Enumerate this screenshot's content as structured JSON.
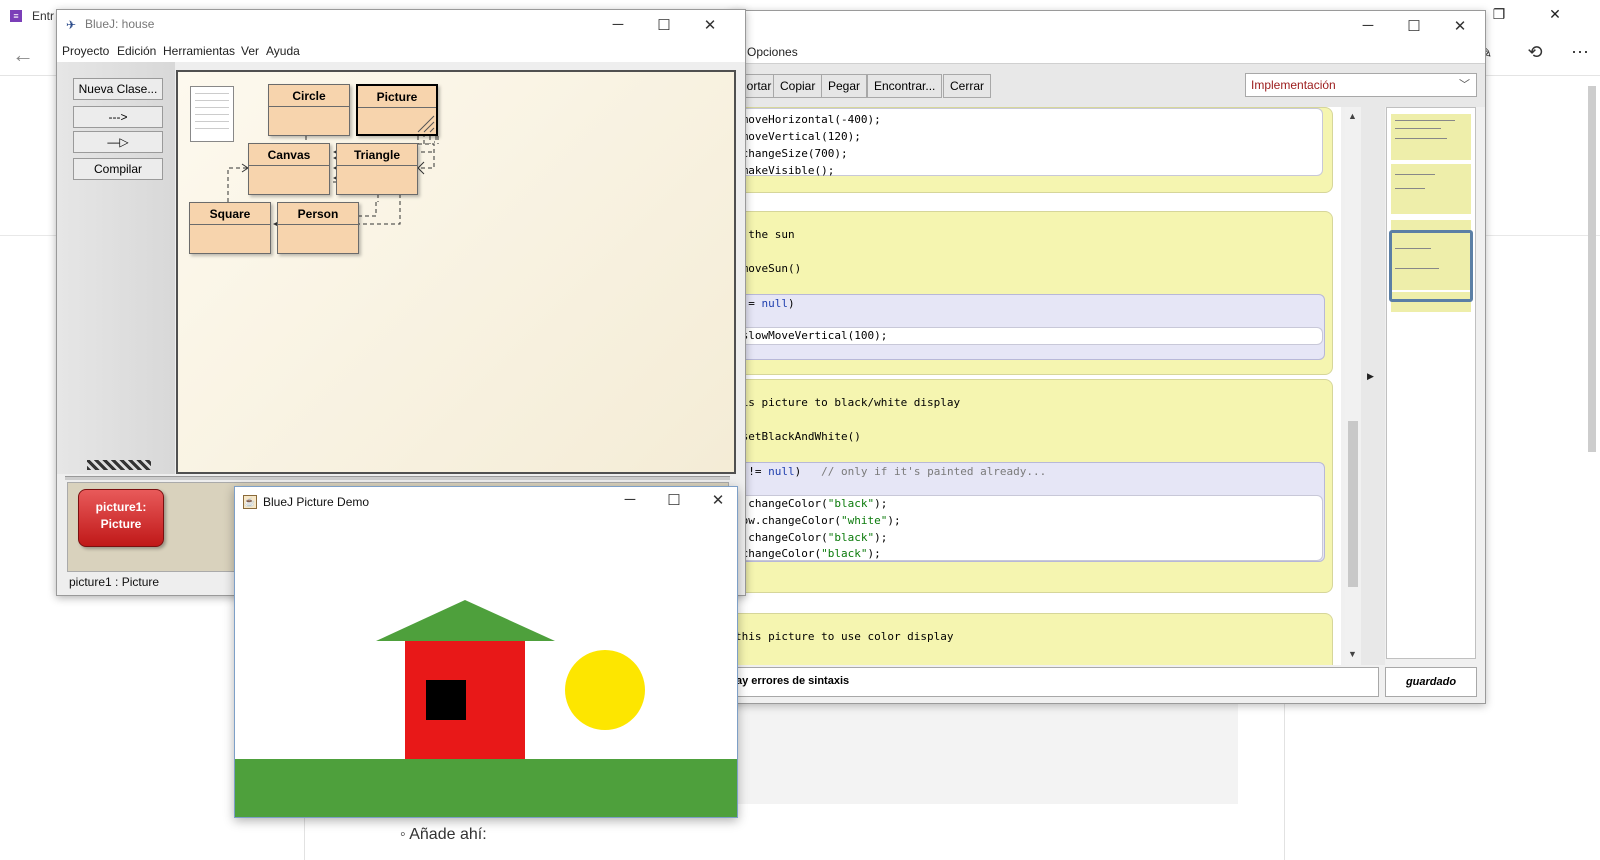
{
  "background": {
    "title": "Entr",
    "bullet_text": "Añade ahí:"
  },
  "editor": {
    "menu": [
      "s",
      "Opciones"
    ],
    "toolbar": [
      "Cortar",
      "Copiar",
      "Pegar",
      "Encontrar...",
      "Cerrar"
    ],
    "view_select": "Implementación",
    "status": "ay errores de sintaxis",
    "saved_label": "guardado",
    "code": {
      "l1": ".moveHorizontal(-400);",
      "l2": ".moveVertical(120);",
      "l3": ".changeSize(700);",
      "l4": ".makeVisible();",
      "l5": "n the sun",
      "l6": " moveSun()",
      "l7a": " != ",
      "l7b": "null",
      "l7c": ")",
      "l8": ".slowMoveVertical(100);",
      "l9": "his picture to black/white display",
      "l10": " setBlackAndWhite()",
      "l11a": "l != ",
      "l11b": "null",
      "l11c": ")   ",
      "l11d": "// only if it's painted already...",
      "l12a": "l.changeColor(",
      "l12b": "\"black\"",
      "l12c": ");",
      "l13a": "dow.changeColor(",
      "l13b": "\"white\"",
      "l13c": ");",
      "l14a": "f.changeColor(",
      "l14b": "\"black\"",
      "l14c": ");",
      "l15a": ".changeColor(",
      "l15b": "\"black\"",
      "l15c": ");",
      "l16": "this picture to use color display"
    }
  },
  "bluej": {
    "title": "BlueJ:  house",
    "menu": [
      "Proyecto",
      "Edición",
      "Herramientas",
      "Ver",
      "Ayuda"
    ],
    "buttons": {
      "new_class": "Nueva Clase...",
      "uses_arrow": "--->",
      "inherits_arrow": "—▷",
      "compile": "Compilar"
    },
    "classes": [
      "Circle",
      "Picture",
      "Canvas",
      "Triangle",
      "Square",
      "Person"
    ],
    "object": {
      "line1": "picture1:",
      "line2": "Picture"
    },
    "status": "picture1 : Picture"
  },
  "picture_demo": {
    "title": "BlueJ Picture Demo",
    "colors": {
      "sky": "#ffffff",
      "grass": "#4ea03c",
      "roof": "#4ea03c",
      "wall": "#e81818",
      "window": "#000000",
      "sun": "#fde600"
    }
  },
  "colors": {
    "code_block": "#f5f5b0",
    "method_body": "#e6e6f6",
    "class_box": "#f7d4ad",
    "object": "#d42020"
  }
}
